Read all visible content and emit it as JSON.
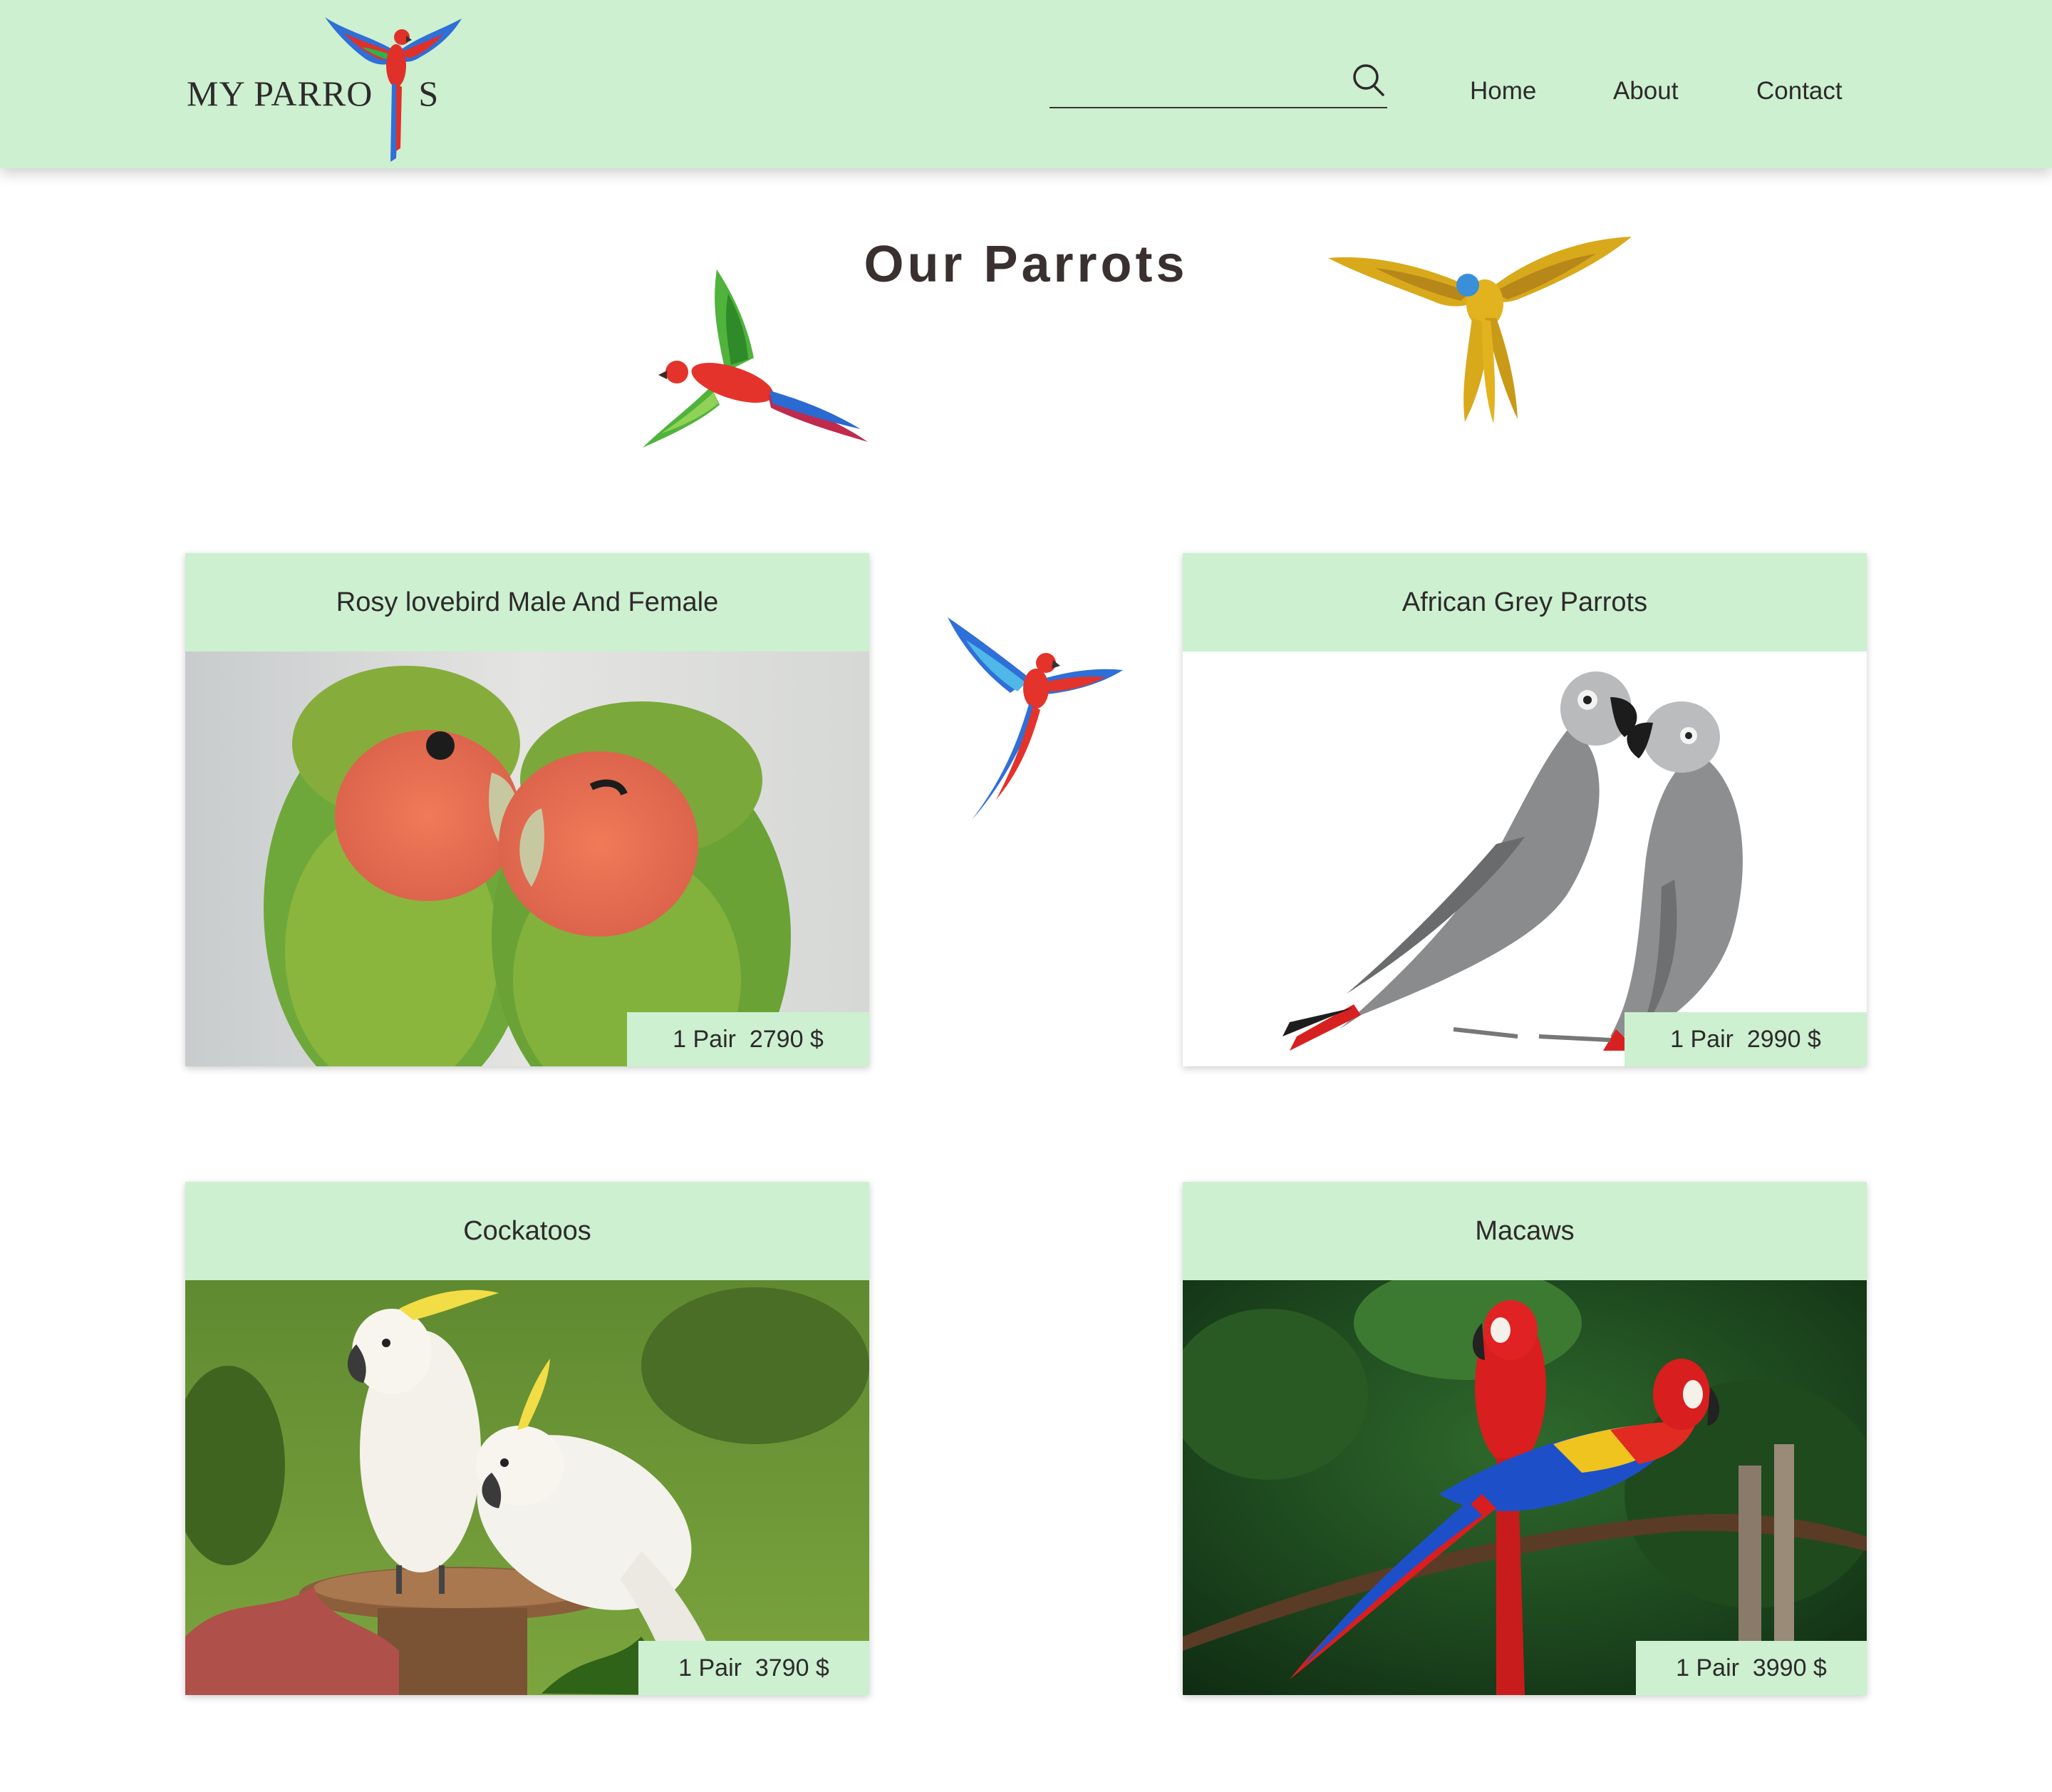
{
  "header": {
    "logo_text_left": "MY PARRO",
    "logo_text_right": "S",
    "search_placeholder": "",
    "nav": {
      "home": "Home",
      "about": "About",
      "contact": "Contact"
    },
    "bg_color": "#ccf0d0"
  },
  "page": {
    "title": "Our Parrots"
  },
  "cards": [
    {
      "title": "Rosy lovebird Male And Female",
      "price": "1 Pair  2790 $",
      "image": "lovebirds-photo"
    },
    {
      "title": "African Grey Parrots",
      "price": "1 Pair  2990 $",
      "image": "african-grey-photo"
    },
    {
      "title": "Cockatoos",
      "price": "1 Pair  3790 $",
      "image": "cockatoos-photo"
    },
    {
      "title": "Macaws",
      "price": "1 Pair  3990 $",
      "image": "macaws-photo"
    }
  ],
  "icons": {
    "search": "search-icon",
    "favorite": "heart-icon",
    "like": "thumbs-up-icon",
    "accent_heart": "#f0483e"
  }
}
